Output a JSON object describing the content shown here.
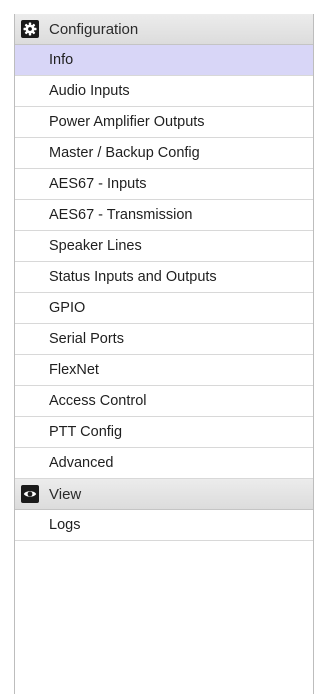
{
  "sections": [
    {
      "title": "Configuration",
      "icon": "gear-icon",
      "items": [
        "Info",
        "Audio Inputs",
        "Power Amplifier Outputs",
        "Master / Backup Config",
        "AES67 - Inputs",
        "AES67 - Transmission",
        "Speaker Lines",
        "Status Inputs and Outputs",
        "GPIO",
        "Serial Ports",
        "FlexNet",
        "Access Control",
        "PTT Config",
        "Advanced"
      ],
      "active_item": "Info"
    },
    {
      "title": "View",
      "icon": "eye-icon",
      "items": [
        "Logs"
      ]
    }
  ],
  "colors": {
    "active_item_bg": "#d8d6f7",
    "header_bg": "#e2e2e2"
  }
}
